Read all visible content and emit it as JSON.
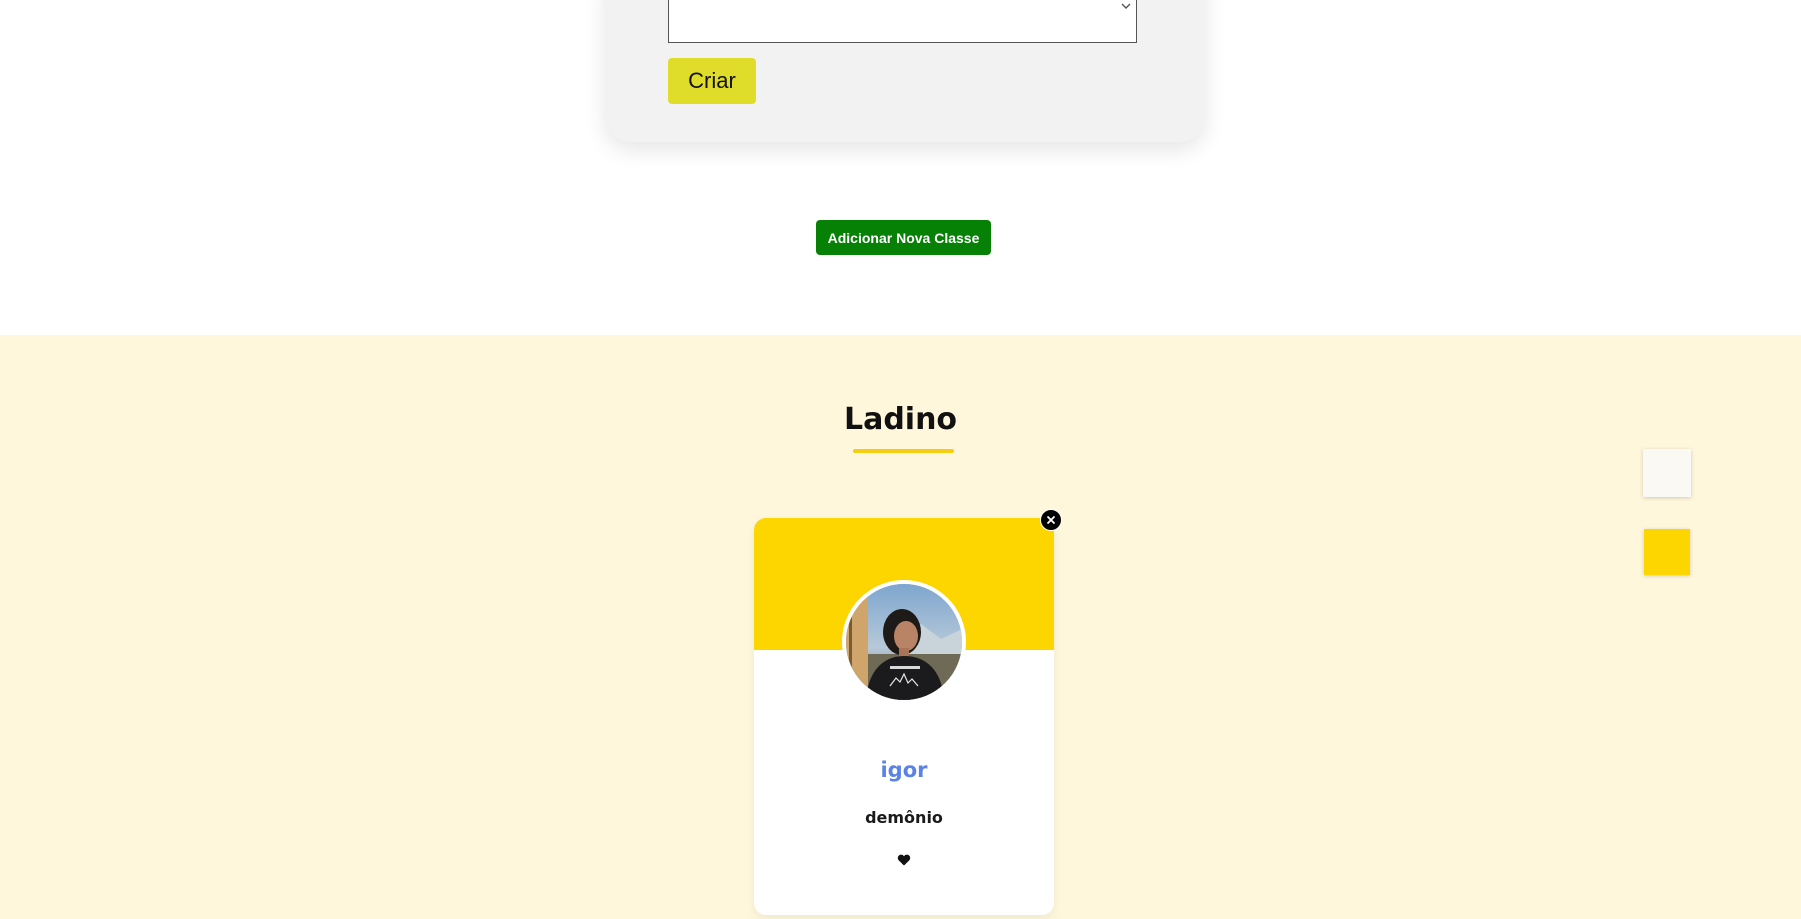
{
  "form": {
    "select_value": "",
    "submit_label": "Criar"
  },
  "add_class_button": {
    "label": "Adicionar Nova Classe",
    "color": "#068106"
  },
  "class_section": {
    "title": "Ladino",
    "background": "#fef7dc",
    "accent": "#f7cd12",
    "cards": [
      {
        "name": "igor",
        "race": "demônio",
        "avatar_icon": "user-photo",
        "favorite_icon": "heart-icon",
        "remove_icon": "close-icon"
      }
    ]
  },
  "side_controls": [
    {
      "color": "#fbf9f4"
    },
    {
      "color": "#fdd600"
    }
  ]
}
